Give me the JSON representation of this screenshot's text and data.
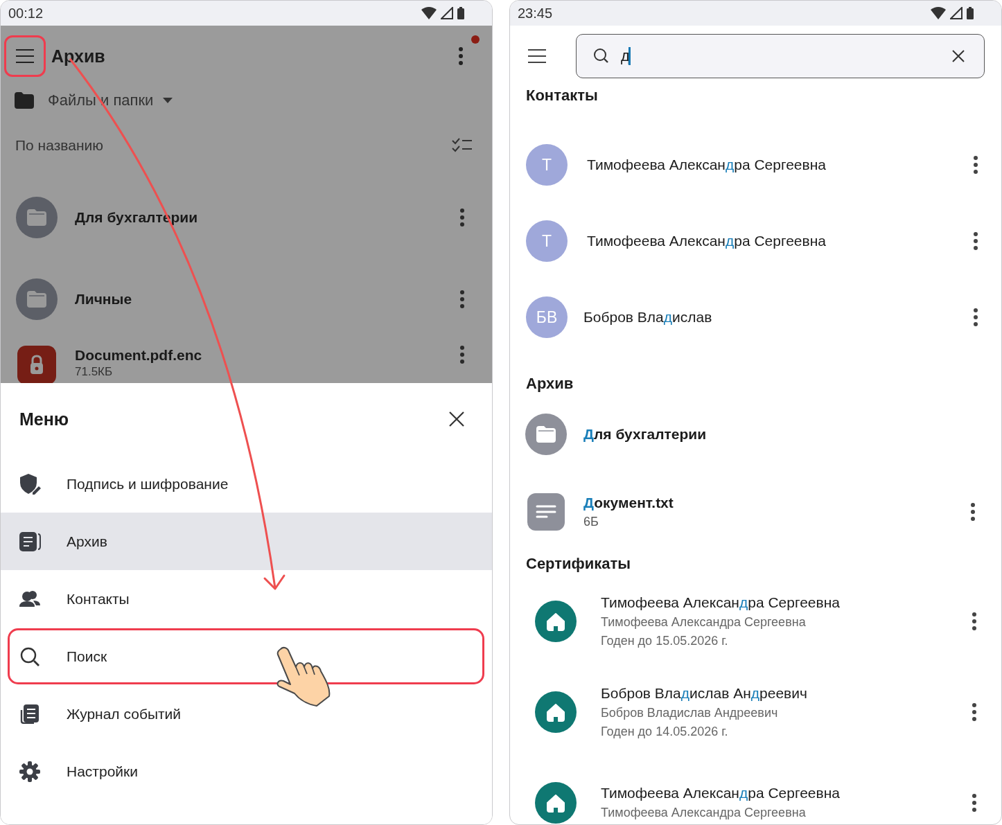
{
  "left_phone": {
    "status_bar": {
      "time": "00:12"
    },
    "app_bar": {
      "title": "Архив",
      "notification": true,
      "menu_highlighted": true
    },
    "location": {
      "label": "Файлы и папки"
    },
    "sort": {
      "label": "По названию"
    },
    "files": [
      {
        "kind": "folder",
        "name": "Для бухгалтерии"
      },
      {
        "kind": "folder",
        "name": "Личные"
      },
      {
        "kind": "encrypted",
        "name": "Document.pdf.enc",
        "size": "71.5КБ"
      }
    ],
    "menu": {
      "title": "Меню",
      "items": [
        {
          "kind": "shield",
          "label": "Подпись и шифрование",
          "selected": false,
          "highlighted": false
        },
        {
          "kind": "archive",
          "label": "Архив",
          "selected": true,
          "highlighted": false
        },
        {
          "kind": "contacts",
          "label": "Контакты",
          "selected": false,
          "highlighted": false
        },
        {
          "kind": "search",
          "label": "Поиск",
          "selected": false,
          "highlighted": true
        },
        {
          "kind": "journal",
          "label": "Журнал событий",
          "selected": false,
          "highlighted": false
        },
        {
          "kind": "settings",
          "label": "Настройки",
          "selected": false,
          "highlighted": false
        }
      ]
    }
  },
  "right_phone": {
    "status_bar": {
      "time": "23:45"
    },
    "search": {
      "value": "д"
    },
    "contacts": {
      "title": "Контакты",
      "items": [
        {
          "initials": "Т",
          "name_parts": [
            {
              "text": "Тимофеева Алексан",
              "match": false
            },
            {
              "text": "д",
              "match": true
            },
            {
              "text": "ра Сергеевна",
              "match": false
            }
          ]
        },
        {
          "initials": "Т",
          "name_parts": [
            {
              "text": "Тимофеева Алексан",
              "match": false
            },
            {
              "text": "д",
              "match": true
            },
            {
              "text": "ра Сергеевна",
              "match": false
            }
          ]
        },
        {
          "initials": "БВ",
          "name_parts": [
            {
              "text": "Бобров Вла",
              "match": false
            },
            {
              "text": "д",
              "match": true
            },
            {
              "text": "ислав",
              "match": false
            }
          ]
        }
      ]
    },
    "archive": {
      "title": "Архив",
      "items": [
        {
          "kind": "folder",
          "name_parts": [
            {
              "text": "Д",
              "match": true
            },
            {
              "text": "ля бухгалтерии",
              "match": false
            }
          ]
        },
        {
          "kind": "text_file",
          "name_parts": [
            {
              "text": "Д",
              "match": true
            },
            {
              "text": "окумент.txt",
              "match": false
            }
          ],
          "size": "6Б"
        }
      ]
    },
    "certificates": {
      "title": "Сертификаты",
      "items": [
        {
          "name_parts": [
            {
              "text": "Тимофеева Алексан",
              "match": false
            },
            {
              "text": "д",
              "match": true
            },
            {
              "text": "ра Сергеевна",
              "match": false
            }
          ],
          "owner": "Тимофеева Александра Сергеевна",
          "valid": "Годен до 15.05.2026 г."
        },
        {
          "name_parts": [
            {
              "text": "Бобров Вла",
              "match": false
            },
            {
              "text": "д",
              "match": true
            },
            {
              "text": "ислав Ан",
              "match": false
            },
            {
              "text": "д",
              "match": true
            },
            {
              "text": "реевич",
              "match": false
            }
          ],
          "owner": "Бобров Владислав Андреевич",
          "valid": "Годен до 14.05.2026 г."
        },
        {
          "name_parts": [
            {
              "text": "Тимофеева Алексан",
              "match": false
            },
            {
              "text": "д",
              "match": true
            },
            {
              "text": "ра Сергеевна",
              "match": false
            }
          ],
          "owner": "Тимофеева Александра Сергеевна"
        }
      ]
    }
  }
}
